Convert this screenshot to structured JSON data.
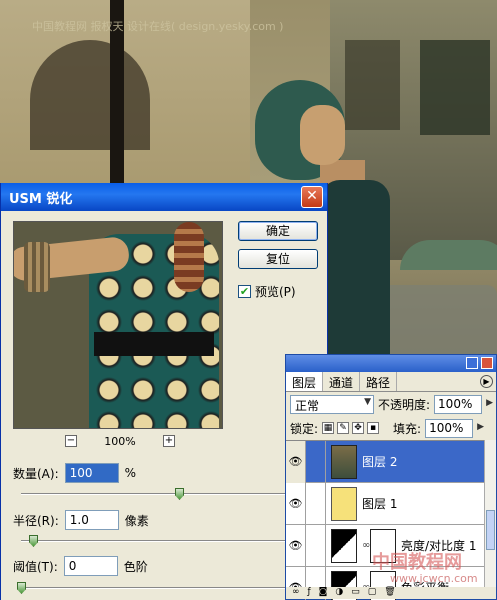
{
  "watermark_top": "中国教程网 报权天 设计在线( design.yesky.com )",
  "watermark_bottom": "中国教程网",
  "watermark_bottom_url": "www.jcwcn.com",
  "dialog": {
    "title": "USM 锐化",
    "close_glyph": "✕",
    "ok_label": "确定",
    "reset_label": "复位",
    "preview_label": "预览(P)",
    "preview_checked": true,
    "zoom_minus": "−",
    "zoom_plus": "+",
    "zoom_value": "100%",
    "amount_label": "数量(A):",
    "amount_value": "100",
    "amount_unit": "%",
    "radius_label": "半径(R):",
    "radius_value": "1.0",
    "radius_unit": "像素",
    "threshold_label": "阈值(T):",
    "threshold_value": "0",
    "threshold_unit": "色阶"
  },
  "layers_panel": {
    "tabs": [
      "图层",
      "通道",
      "路径"
    ],
    "blend_mode": "正常",
    "opacity_label": "不透明度:",
    "opacity_value": "100%",
    "lock_label": "锁定:",
    "fill_label": "填充:",
    "fill_value": "100%",
    "layers": [
      {
        "name": "图层 2",
        "selected": true
      },
      {
        "name": "图层 1",
        "selected": false
      },
      {
        "name": "亮度/对比度 1",
        "selected": false
      },
      {
        "name": "色彩平衡",
        "selected": false
      }
    ]
  },
  "colors": {
    "title_bar": "#0a5ee8",
    "selected_layer": "#3b68c8",
    "yellow_layer": "#f6e17a"
  }
}
